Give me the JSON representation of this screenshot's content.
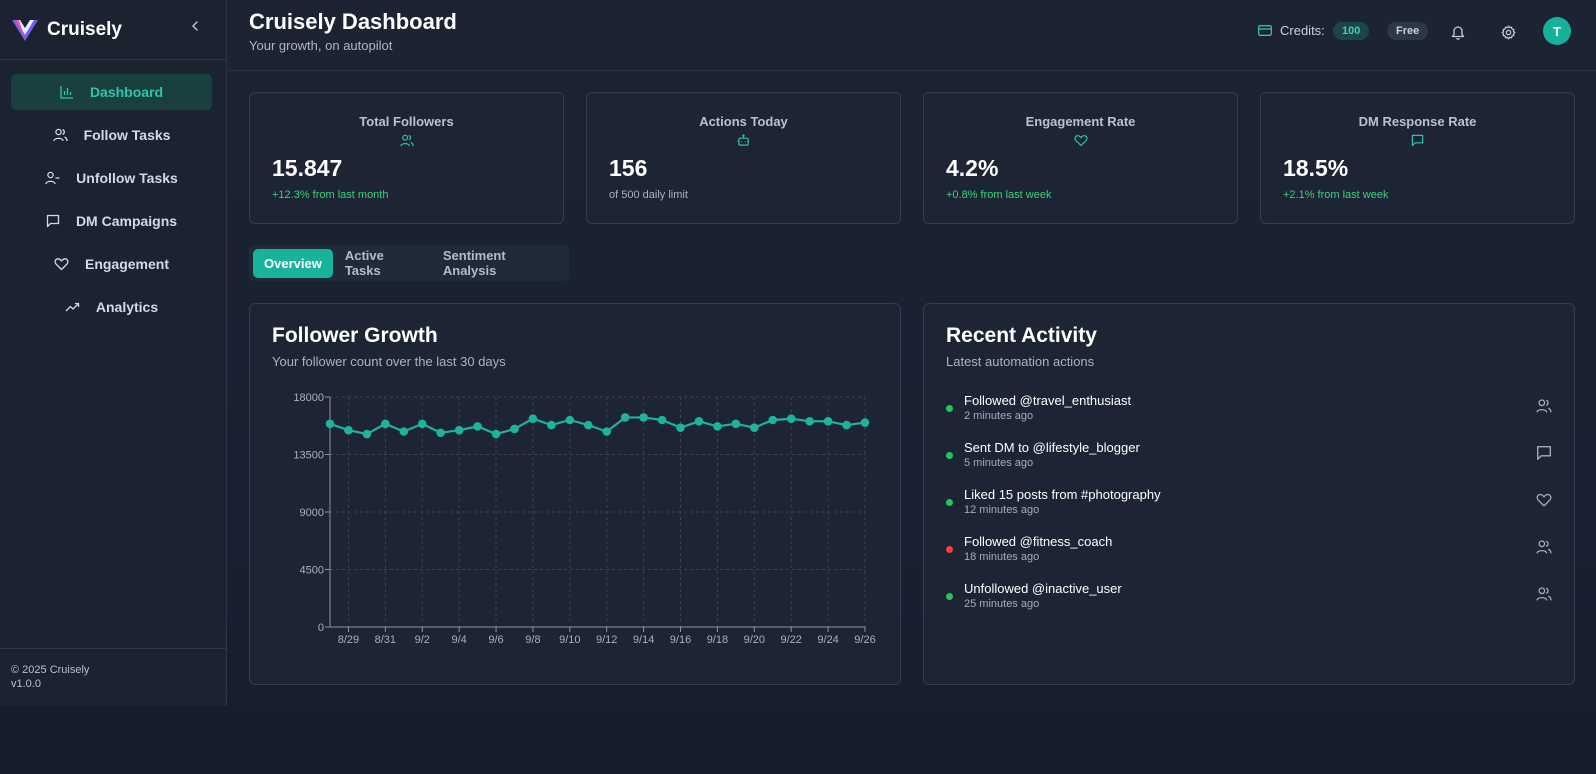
{
  "brand": {
    "name": "Cruisely"
  },
  "sidebar": {
    "items": [
      {
        "label": "Dashboard",
        "icon": "bar-chart-icon",
        "active": true
      },
      {
        "label": "Follow Tasks",
        "icon": "users-icon",
        "active": false
      },
      {
        "label": "Unfollow Tasks",
        "icon": "user-minus-icon",
        "active": false
      },
      {
        "label": "DM Campaigns",
        "icon": "message-square-icon",
        "active": false
      },
      {
        "label": "Engagement",
        "icon": "heart-icon",
        "active": false
      },
      {
        "label": "Analytics",
        "icon": "trending-up-icon",
        "active": false
      }
    ],
    "footer": {
      "copyright": "© 2025 Cruisely",
      "version": "v1.0.0"
    }
  },
  "header": {
    "title": "Cruisely Dashboard",
    "subtitle": "Your growth, on autopilot",
    "credits_label": "Credits:",
    "credits_value": "100",
    "plan": "Free",
    "avatar_initial": "T"
  },
  "stats": [
    {
      "title": "Total Followers",
      "icon": "users-icon",
      "value": "15.847",
      "sub": "+12.3% from last month",
      "positive": true
    },
    {
      "title": "Actions Today",
      "icon": "bot-icon",
      "value": "156",
      "sub": "of 500 daily limit",
      "positive": false
    },
    {
      "title": "Engagement Rate",
      "icon": "heart-icon",
      "value": "4.2%",
      "sub": "+0.8% from last week",
      "positive": true
    },
    {
      "title": "DM Response Rate",
      "icon": "message-square-icon",
      "value": "18.5%",
      "sub": "+2.1% from last week",
      "positive": true
    }
  ],
  "tabs": [
    {
      "label": "Overview",
      "active": true
    },
    {
      "label": "Active Tasks",
      "active": false
    },
    {
      "label": "Sentiment Analysis",
      "active": false
    }
  ],
  "growth_panel": {
    "title": "Follower Growth",
    "subtitle": "Your follower count over the last 30 days"
  },
  "chart_data": {
    "type": "line",
    "title": "Follower Growth",
    "x": [
      "8/28",
      "8/29",
      "8/30",
      "8/31",
      "9/1",
      "9/2",
      "9/3",
      "9/4",
      "9/5",
      "9/6",
      "9/7",
      "9/8",
      "9/9",
      "9/10",
      "9/11",
      "9/12",
      "9/13",
      "9/14",
      "9/15",
      "9/16",
      "9/17",
      "9/18",
      "9/19",
      "9/20",
      "9/21",
      "9/22",
      "9/23",
      "9/24",
      "9/25",
      "9/26"
    ],
    "x_tick_labels": [
      "8/29",
      "8/31",
      "9/2",
      "9/4",
      "9/6",
      "9/8",
      "9/10",
      "9/12",
      "9/14",
      "9/16",
      "9/18",
      "9/20",
      "9/22",
      "9/24",
      "9/26"
    ],
    "series": [
      {
        "values": [
          15900,
          15400,
          15100,
          15900,
          15300,
          15900,
          15200,
          15400,
          15700,
          15100,
          15500,
          16300,
          15800,
          16200,
          15800,
          15300,
          16400,
          16400,
          16200,
          15600,
          16100,
          15700,
          15900,
          15600,
          16200,
          16300,
          16100,
          16100,
          15800,
          16000
        ]
      }
    ],
    "y_ticks": [
      0,
      4500,
      9000,
      13500,
      18000
    ],
    "ylim": [
      0,
      18000
    ],
    "grid": true,
    "color": "#1fb39d"
  },
  "activity_panel": {
    "title": "Recent Activity",
    "subtitle": "Latest automation actions",
    "items": [
      {
        "title": "Followed @travel_enthusiast",
        "time": "2 minutes ago",
        "status_color": "#22c55e",
        "icon": "users-icon"
      },
      {
        "title": "Sent DM to @lifestyle_blogger",
        "time": "5 minutes ago",
        "status_color": "#22c55e",
        "icon": "message-square-icon"
      },
      {
        "title": "Liked 15 posts from #photography",
        "time": "12 minutes ago",
        "status_color": "#22c55e",
        "icon": "heart-icon"
      },
      {
        "title": "Followed @fitness_coach",
        "time": "18 minutes ago",
        "status_color": "#ef4444",
        "icon": "users-icon"
      },
      {
        "title": "Unfollowed @inactive_user",
        "time": "25 minutes ago",
        "status_color": "#22c55e",
        "icon": "users-icon"
      }
    ]
  },
  "colors": {
    "accent": "#19b39c",
    "positive": "#36d37a",
    "negative": "#ef4444"
  }
}
